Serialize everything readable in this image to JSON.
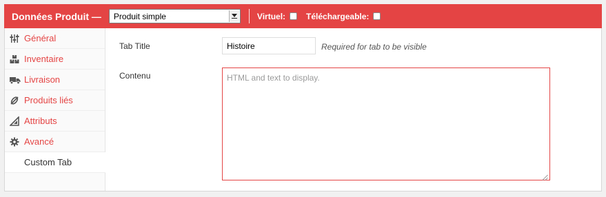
{
  "header": {
    "title": "Données Produit —",
    "product_type_selected": "Produit simple",
    "virtual_label": "Virtuel:",
    "downloadable_label": "Téléchargeable:",
    "accent_color": "#e54444"
  },
  "sidebar": {
    "items": [
      {
        "label": "Général",
        "icon": "sliders-icon"
      },
      {
        "label": "Inventaire",
        "icon": "boxes-icon"
      },
      {
        "label": "Livraison",
        "icon": "truck-icon"
      },
      {
        "label": "Produits liés",
        "icon": "link-icon"
      },
      {
        "label": "Attributs",
        "icon": "ruler-icon"
      },
      {
        "label": "Avancé",
        "icon": "gear-icon"
      },
      {
        "label": "Custom Tab",
        "icon": ""
      }
    ],
    "active_index": 6
  },
  "form": {
    "tab_title_label": "Tab Title",
    "tab_title_value": "Histoire",
    "tab_title_hint": "Required for tab to be visible",
    "content_label": "Contenu",
    "content_placeholder": "HTML and text to display."
  }
}
